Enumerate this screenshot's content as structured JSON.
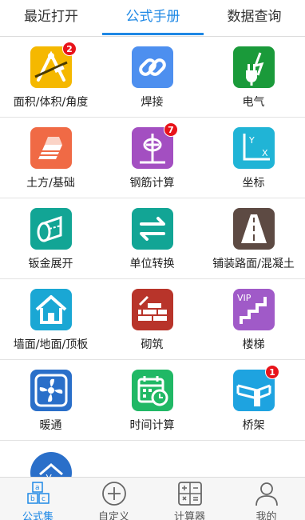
{
  "tabs": [
    {
      "label": "最近打开"
    },
    {
      "label": "公式手册"
    },
    {
      "label": "数据查询"
    }
  ],
  "grid": [
    {
      "label": "面积/体积/角度",
      "icon": "geometry-tools-icon",
      "color": "#f5b800",
      "badge": "2"
    },
    {
      "label": "焊接",
      "icon": "chain-link-icon",
      "color": "#4d8fef",
      "badge": ""
    },
    {
      "label": "电气",
      "icon": "electric-plug-icon",
      "color": "#1a9a3a",
      "badge": ""
    },
    {
      "label": "土方/基础",
      "icon": "foundation-block-icon",
      "color": "#f06a45",
      "badge": ""
    },
    {
      "label": "钢筋计算",
      "icon": "rebar-icon",
      "color": "#a34fc1",
      "badge": "7"
    },
    {
      "label": "坐标",
      "icon": "xy-axis-icon",
      "color": "#20b4d6",
      "badge": ""
    },
    {
      "label": "钣金展开",
      "icon": "cylinder-unfold-icon",
      "color": "#12a595",
      "badge": ""
    },
    {
      "label": "单位转换",
      "icon": "swap-arrows-icon",
      "color": "#12a595",
      "badge": ""
    },
    {
      "label": "铺装路面/混凝土",
      "icon": "road-icon",
      "color": "#5d4a43",
      "badge": ""
    },
    {
      "label": "墙面/地面/顶板",
      "icon": "house-icon",
      "color": "#1aa7d4",
      "badge": ""
    },
    {
      "label": "砌筑",
      "icon": "brick-wall-icon",
      "color": "#b8342a",
      "badge": ""
    },
    {
      "label": "楼梯",
      "icon": "vip-stairs-icon",
      "color": "#a05ac8",
      "badge": ""
    },
    {
      "label": "暖通",
      "icon": "fan-icon",
      "color": "#2a6fc9",
      "badge": ""
    },
    {
      "label": "时间计算",
      "icon": "calendar-clock-icon",
      "color": "#20b865",
      "badge": ""
    },
    {
      "label": "桥架",
      "icon": "cable-tray-icon",
      "color": "#1ea3e0",
      "badge": "1"
    },
    {
      "label": "",
      "icon": "house-yuan-icon",
      "color": "#2a6fc9",
      "badge": ""
    }
  ],
  "bottom_nav": [
    {
      "label": "公式集",
      "icon": "abc-blocks-icon"
    },
    {
      "label": "自定义",
      "icon": "plus-circle-icon"
    },
    {
      "label": "计算器",
      "icon": "calculator-icon"
    },
    {
      "label": "我的",
      "icon": "person-icon"
    }
  ],
  "accent_color": "#1e88e5"
}
